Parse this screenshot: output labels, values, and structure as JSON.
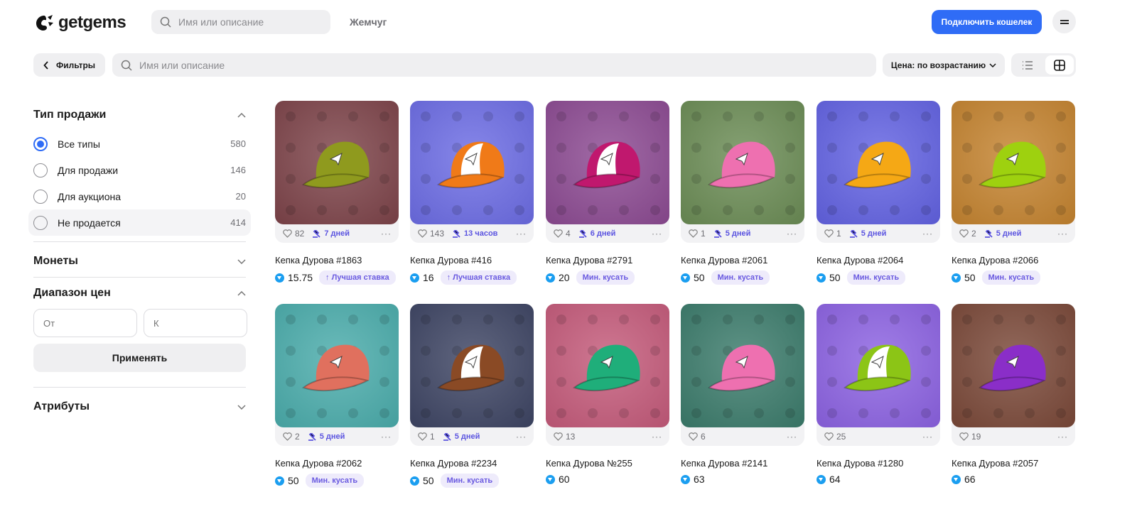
{
  "header": {
    "logo": "getgems",
    "search_placeholder": "Имя или описание",
    "nav_link": "Жемчуг",
    "connect_label": "Подключить кошелек"
  },
  "toolbar": {
    "filters_label": "Фильтры",
    "search_placeholder": "Имя или описание",
    "sort_label": "Цена: по возрастанию"
  },
  "sidebar": {
    "sale_type": {
      "title": "Тип продажи",
      "options": [
        {
          "label": "Все типы",
          "count": "580"
        },
        {
          "label": "Для продажи",
          "count": "146"
        },
        {
          "label": "Для аукциона",
          "count": "20"
        },
        {
          "label": "Не продается",
          "count": "414"
        }
      ]
    },
    "coins": {
      "title": "Монеты"
    },
    "price_range": {
      "title": "Диапазон цен",
      "from_placeholder": "От",
      "to_placeholder": "К",
      "apply_label": "Применять"
    },
    "attributes": {
      "title": "Атрибуты"
    }
  },
  "items": [
    {
      "name": "Кепка Дурова #1863",
      "likes": "82",
      "time": "7 дней",
      "price": "15.75",
      "badge": "↑ Лучшая ставка",
      "bg": "#7d4349",
      "cap": "#8f9a1e",
      "front": "#8f9a1e"
    },
    {
      "name": "Кепка Дурова #416",
      "likes": "143",
      "time": "13 часов",
      "price": "16",
      "badge": "↑ Лучшая ставка",
      "bg": "#6c6ce4",
      "cap": "#f07a18",
      "front": "#ffffff"
    },
    {
      "name": "Кепка Дурова #2791",
      "likes": "4",
      "time": "6 дней",
      "price": "20",
      "badge": "Мин. кусать",
      "bg": "#8c4a92",
      "cap": "#c0186e",
      "front": "#ffffff"
    },
    {
      "name": "Кепка Дурова #2061",
      "likes": "1",
      "time": "5 дней",
      "price": "50",
      "badge": "Мин. кусать",
      "bg": "#6b8c55",
      "cap": "#ee70b0",
      "front": "#ee70b0"
    },
    {
      "name": "Кепка Дурова #2064",
      "likes": "1",
      "time": "5 дней",
      "price": "50",
      "badge": "Мин. кусать",
      "bg": "#6262e2",
      "cap": "#f5a815",
      "front": "#f5a815"
    },
    {
      "name": "Кепка Дурова #2066",
      "likes": "2",
      "time": "5 дней",
      "price": "50",
      "badge": "Мин. кусать",
      "bg": "#c4832f",
      "cap": "#9ed10f",
      "front": "#9ed10f"
    },
    {
      "name": "Кепка Дурова #2062",
      "likes": "2",
      "time": "5 дней",
      "price": "50",
      "badge": "Мин. кусать",
      "bg": "#4aacab",
      "cap": "#e0705e",
      "front": "#e0705e"
    },
    {
      "name": "Кепка Дурова #2234",
      "likes": "1",
      "time": "5 дней",
      "price": "50",
      "badge": "Мин. кусать",
      "bg": "#3d4463",
      "cap": "#8a4a25",
      "front": "#ffffff"
    },
    {
      "name": "Кепка Дурова №255",
      "likes": "13",
      "time": "",
      "price": "60",
      "badge": "",
      "bg": "#c45a7a",
      "cap": "#1fae7a",
      "front": "#1fae7a"
    },
    {
      "name": "Кепка Дурова #2141",
      "likes": "6",
      "time": "",
      "price": "63",
      "badge": "",
      "bg": "#3b7b6b",
      "cap": "#ee70b0",
      "front": "#ee70b0"
    },
    {
      "name": "Кепка Дурова #1280",
      "likes": "25",
      "time": "",
      "price": "64",
      "badge": "",
      "bg": "#8c62e2",
      "cap": "#8cc516",
      "front": "#ffffff"
    },
    {
      "name": "Кепка Дурова #2057",
      "likes": "19",
      "time": "",
      "price": "66",
      "badge": "",
      "bg": "#7a4838",
      "cap": "#8a2ec8",
      "front": "#8a2ec8"
    }
  ]
}
